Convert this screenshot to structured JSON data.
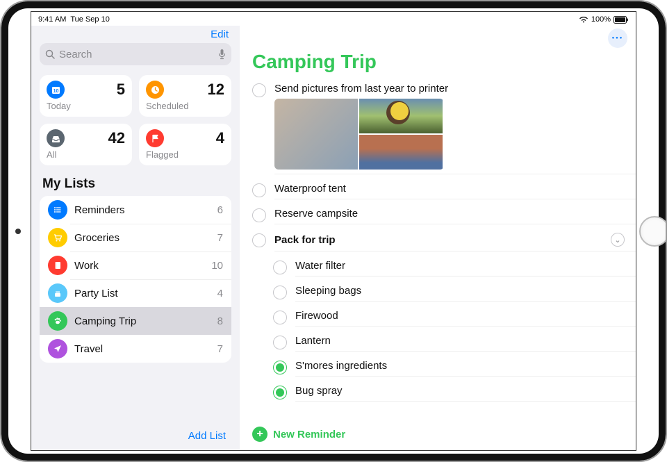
{
  "colors": {
    "green": "#34c759",
    "blue": "#007aff"
  },
  "status": {
    "time": "9:41 AM",
    "date": "Tue Sep 10",
    "battery": "100%"
  },
  "sidebar": {
    "edit": "Edit",
    "search_placeholder": "Search",
    "smart_lists": [
      {
        "label": "Today",
        "count": "5",
        "icon": "calendar",
        "color": "#007aff"
      },
      {
        "label": "Scheduled",
        "count": "12",
        "icon": "clock",
        "color": "#ff9500"
      },
      {
        "label": "All",
        "count": "42",
        "icon": "inbox",
        "color": "#5b6670"
      },
      {
        "label": "Flagged",
        "count": "4",
        "icon": "flag",
        "color": "#ff3b30"
      }
    ],
    "section_title": "My Lists",
    "lists": [
      {
        "name": "Reminders",
        "count": "6",
        "icon": "list",
        "color": "#007aff"
      },
      {
        "name": "Groceries",
        "count": "7",
        "icon": "cart",
        "color": "#ffcc00"
      },
      {
        "name": "Work",
        "count": "10",
        "icon": "book",
        "color": "#ff3b30"
      },
      {
        "name": "Party List",
        "count": "4",
        "icon": "cake",
        "color": "#5ac8fa"
      },
      {
        "name": "Camping Trip",
        "count": "8",
        "icon": "paw",
        "color": "#34c759",
        "selected": true
      },
      {
        "name": "Travel",
        "count": "7",
        "icon": "plane",
        "color": "#af52de"
      }
    ],
    "add_list": "Add List"
  },
  "main": {
    "title": "Camping Trip",
    "title_color": "#34c759",
    "reminders": [
      {
        "text": "Send pictures from last year to printer",
        "checked": false,
        "has_photos": true
      },
      {
        "text": "Waterproof tent",
        "checked": false
      },
      {
        "text": "Reserve campsite",
        "checked": false
      },
      {
        "text": "Pack for trip",
        "checked": false,
        "is_header": true,
        "children": [
          {
            "text": "Water filter",
            "checked": false
          },
          {
            "text": "Sleeping bags",
            "checked": false
          },
          {
            "text": "Firewood",
            "checked": false
          },
          {
            "text": "Lantern",
            "checked": false
          },
          {
            "text": "S'mores ingredients",
            "checked": true
          },
          {
            "text": "Bug spray",
            "checked": true
          }
        ]
      }
    ],
    "new_reminder": "New Reminder"
  }
}
